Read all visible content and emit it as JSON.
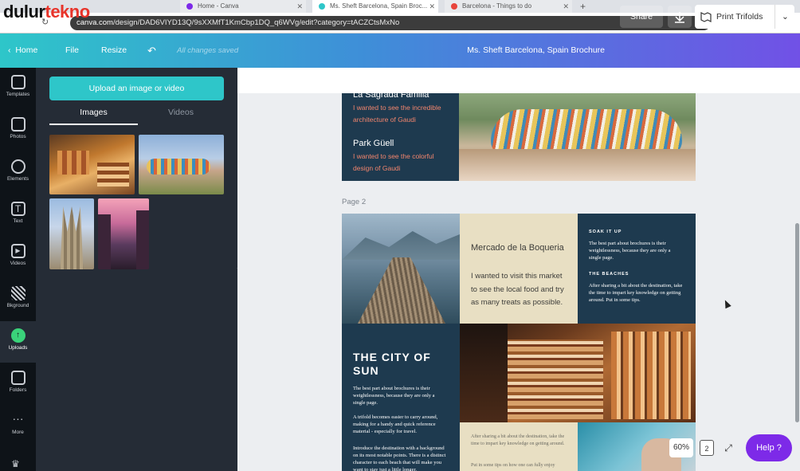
{
  "watermark": {
    "part1": "dulur",
    "part2": "tekno"
  },
  "browser": {
    "tabs": [
      {
        "label": "Home - Canva",
        "fav": "#7d2ae8"
      },
      {
        "label": "Ms. Sheft Barcelona, Spain Broc...",
        "fav": "#2ec6c9"
      },
      {
        "label": "Barcelona - Things to do",
        "fav": "#e8453c"
      }
    ],
    "url_host": "canva.com",
    "url_path": "/design/DAD6VIYD13Q/9sXXMfT1KmCbp1DQ_q6WVg/edit?category=tACZCtsMxNo"
  },
  "header": {
    "home": "Home",
    "file": "File",
    "resize": "Resize",
    "saved": "All changes saved",
    "doc_title": "Ms. Sheft Barcelona, Spain Brochure",
    "share": "Share",
    "print": "Print Trifolds"
  },
  "leftnav": [
    {
      "label": "Templates",
      "color": "#c9cdd3"
    },
    {
      "label": "Photos",
      "color": "#c9cdd3"
    },
    {
      "label": "Elements",
      "color": "#c9cdd3"
    },
    {
      "label": "Text",
      "color": "#c9cdd3"
    },
    {
      "label": "Videos",
      "color": "#c9cdd3"
    },
    {
      "label": "Bkground",
      "color": "#c9cdd3"
    },
    {
      "label": "Uploads",
      "color": "#3ad37a"
    },
    {
      "label": "Folders",
      "color": "#c9cdd3"
    },
    {
      "label": "More",
      "color": "#c9cdd3"
    }
  ],
  "panel": {
    "upload_button": "Upload an image or video",
    "tab_images": "Images",
    "tab_videos": "Videos"
  },
  "canvas": {
    "page1": {
      "heading_top": "La Sagrada Familia",
      "text1": "I wanted to see the incredible architecture of Gaudi",
      "heading2": "Park Güell",
      "text2": "I wanted to see the colorful design of Gaudi"
    },
    "page2_label": "Page 2",
    "page2": {
      "mercado_title": "Mercado de la Boqueria",
      "mercado_text": "I wanted to visit this market to see the local food and try as many treats as possible.",
      "soak_heading": "SOAK IT UP",
      "soak_text": "The best part about brochures is their weightlessness, because they are only a single page.",
      "beaches_heading": "THE BEACHES",
      "beaches_text": "After sharing a bit about the destination, take the time to impart key knowledge on getting around. Put in some tips.",
      "city_title": "THE CITY OF SUN",
      "city_p1": "The best part about brochures is their weightlessness, because they are only a single page.",
      "city_p2": "A trifold becomes easier to carry around, making for a handy and quick reference material - especially for travel.",
      "city_p3": "Introduce the destination with a background on its most notable points. There is a distinct character to each beach that will make you want to stay just a little longer.",
      "bottom_p1": "After sharing a bit about the destination, take the time to impart key knowledge on getting around.",
      "bottom_p2": "Put in some tips on how one can fully enjoy"
    }
  },
  "controls": {
    "zoom": "60%",
    "pages": "2",
    "help": "Help ?"
  }
}
